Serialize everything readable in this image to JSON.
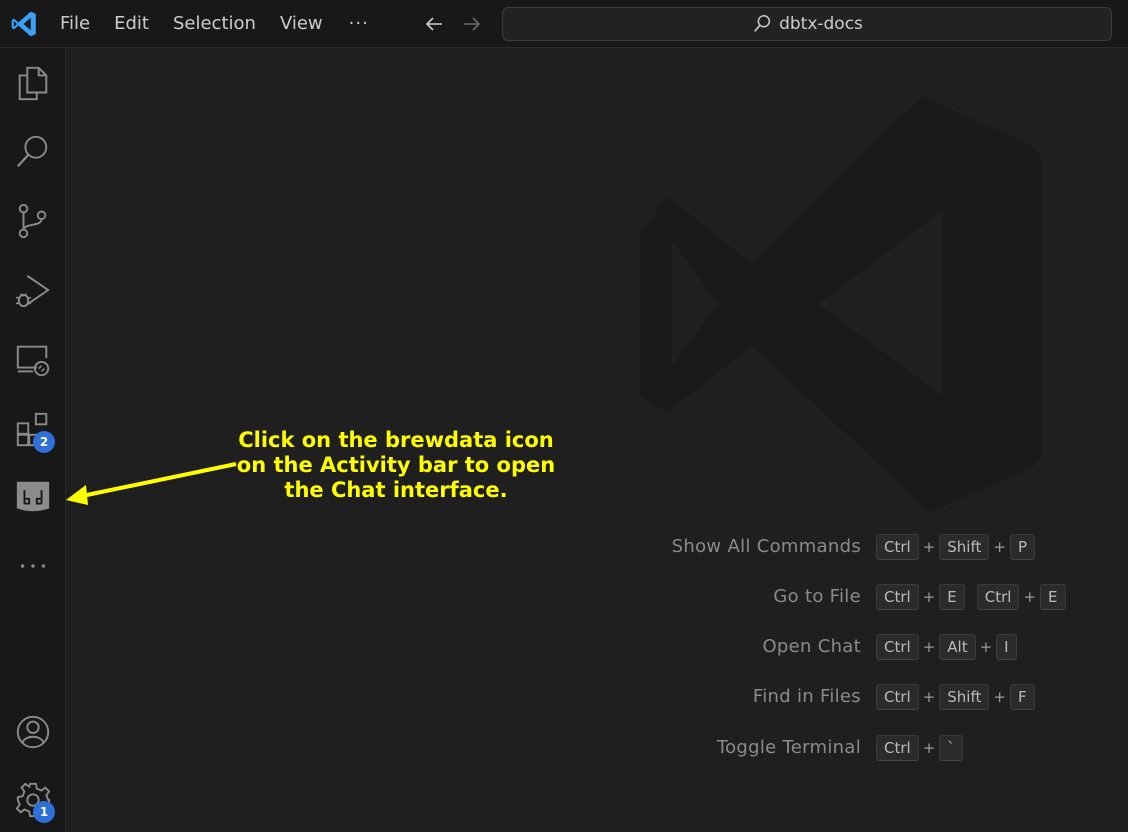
{
  "titlebar": {
    "menu": [
      "File",
      "Edit",
      "Selection",
      "View"
    ],
    "more": "···",
    "search_label": "dbtx-docs"
  },
  "activitybar": {
    "items": [
      {
        "name": "explorer",
        "icon": "files-icon"
      },
      {
        "name": "search",
        "icon": "search-icon"
      },
      {
        "name": "source-control",
        "icon": "source-control-icon"
      },
      {
        "name": "run-debug",
        "icon": "run-debug-icon"
      },
      {
        "name": "remote-explorer",
        "icon": "remote-explorer-icon"
      },
      {
        "name": "extensions",
        "icon": "extensions-icon",
        "badge": "2"
      },
      {
        "name": "brewdata",
        "icon": "brewdata-icon"
      },
      {
        "name": "more",
        "icon": "ellipsis-icon"
      }
    ],
    "account_icon": "account-icon",
    "manage": {
      "icon": "gear-icon",
      "badge": "1"
    }
  },
  "shortcuts": [
    {
      "label": "Show All Commands",
      "keys": [
        [
          "Ctrl",
          "Shift",
          "P"
        ]
      ]
    },
    {
      "label": "Go to File",
      "keys": [
        [
          "Ctrl",
          "E"
        ],
        [
          "Ctrl",
          "E"
        ]
      ]
    },
    {
      "label": "Open Chat",
      "keys": [
        [
          "Ctrl",
          "Alt",
          "I"
        ]
      ]
    },
    {
      "label": "Find in Files",
      "keys": [
        [
          "Ctrl",
          "Shift",
          "F"
        ]
      ]
    },
    {
      "label": "Toggle Terminal",
      "keys": [
        [
          "Ctrl",
          "`"
        ]
      ]
    }
  ],
  "annotation": {
    "lines": [
      "Click on the brewdata icon",
      "on the Activity bar to open",
      "the Chat interface."
    ],
    "color": "#ffff00"
  },
  "colors": {
    "editor_bg": "#1f1f1f",
    "bar_bg": "#181818",
    "badge": "#2e6fd8",
    "logo": "#3ca1f5"
  }
}
